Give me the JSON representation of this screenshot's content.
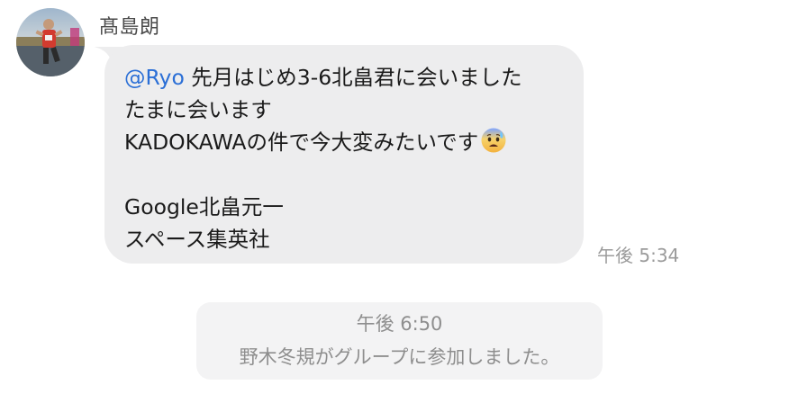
{
  "message": {
    "sender": "髙島朗",
    "mention": "@Ryo",
    "lines": [
      " 先月はじめ3-6北畠君に会いました",
      "たまに会います",
      "KADOKAWAの件で今大変みたいです",
      "",
      "Google北畠元一",
      "スペース集英社"
    ],
    "emoji": "anxious-face-with-sweat-icon",
    "time": "午後 5:34"
  },
  "system_notice": {
    "time": "午後 6:50",
    "text": "野木冬規がグループに参加しました。"
  },
  "colors": {
    "bubble": "#ededee",
    "mention": "#2b6fd6",
    "system_bg": "#f3f3f4",
    "meta_text": "#9b9b9b"
  }
}
